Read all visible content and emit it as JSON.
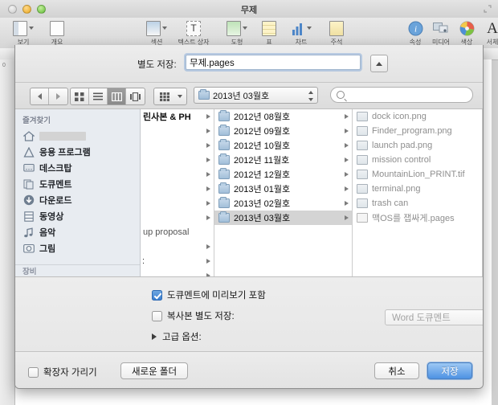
{
  "app": {
    "title": "무제",
    "window_controls": [
      "close",
      "minimize",
      "zoom"
    ],
    "toolbar_left": [
      {
        "label": "보기",
        "icon": "view-icon",
        "has_menu": true
      },
      {
        "label": "개요",
        "icon": "outline-icon",
        "has_menu": false
      }
    ],
    "toolbar_center": [
      {
        "label": "섹션",
        "icon": "sections-icon",
        "has_menu": true
      },
      {
        "label": "텍스트 상자",
        "icon": "textbox-icon",
        "has_menu": false
      },
      {
        "label": "도형",
        "icon": "shapes-icon",
        "has_menu": true
      },
      {
        "label": "표",
        "icon": "table-icon",
        "has_menu": false
      },
      {
        "label": "차트",
        "icon": "chart-icon",
        "has_menu": true
      },
      {
        "label": "주석",
        "icon": "comment-icon",
        "has_menu": false
      }
    ],
    "toolbar_right": [
      {
        "label": "속성",
        "icon": "inspector-icon"
      },
      {
        "label": "미디어",
        "icon": "media-icon"
      },
      {
        "label": "색상",
        "icon": "colors-icon"
      },
      {
        "label": "서체",
        "icon": "fonts-icon"
      }
    ],
    "ruler_mark": "0"
  },
  "sheet": {
    "save_as_label": "별도 저장:",
    "filename_value": "무제.pages",
    "expand_button_icon": "triangle-up-icon",
    "nav": {
      "back_icon": "arrow-left-icon",
      "forward_icon": "arrow-right-icon",
      "view_modes": [
        {
          "name": "icon-view",
          "selected": false
        },
        {
          "name": "list-view",
          "selected": false
        },
        {
          "name": "column-view",
          "selected": true
        },
        {
          "name": "coverflow-view",
          "selected": false
        }
      ],
      "arrange_icon": "arrange-icon",
      "path_label": "2013년 03월호",
      "search_placeholder": ""
    },
    "sidebar": {
      "header": "즐겨찾기",
      "items": [
        {
          "label": "",
          "icon": "home-icon",
          "redacted": true
        },
        {
          "label": "응용 프로그램",
          "icon": "applications-icon"
        },
        {
          "label": "데스크탑",
          "icon": "desktop-icon"
        },
        {
          "label": "도큐멘트",
          "icon": "documents-icon"
        },
        {
          "label": "다운로드",
          "icon": "downloads-icon"
        },
        {
          "label": "동영상",
          "icon": "movies-icon"
        },
        {
          "label": "음악",
          "icon": "music-icon"
        },
        {
          "label": "그림",
          "icon": "pictures-icon"
        }
      ],
      "devices_header": "장비"
    },
    "columns": [
      {
        "name": "column-1",
        "items": [
          {
            "label": "린사본 & PH",
            "type": "folder",
            "truncated": true,
            "selected": false
          },
          {
            "label": "",
            "type": "blank"
          },
          {
            "label": "",
            "type": "blank"
          },
          {
            "label": "",
            "type": "blank"
          },
          {
            "label": "",
            "type": "blank"
          },
          {
            "label": "",
            "type": "blank"
          },
          {
            "label": "",
            "type": "blank"
          },
          {
            "label": "",
            "type": "blank"
          },
          {
            "label": "up proposal",
            "type": "folder",
            "truncated": true,
            "selected": false
          },
          {
            "label": "",
            "type": "blank"
          },
          {
            "label": "",
            "type": "blank"
          }
        ]
      },
      {
        "name": "column-2",
        "items": [
          {
            "label": "2012년 08월호",
            "type": "folder",
            "selected": false
          },
          {
            "label": "2012년 09월호",
            "type": "folder",
            "selected": false
          },
          {
            "label": "2012년 10월호",
            "type": "folder",
            "selected": false
          },
          {
            "label": "2012년 11월호",
            "type": "folder",
            "selected": false
          },
          {
            "label": "2012년 12월호",
            "type": "folder",
            "selected": false
          },
          {
            "label": "2013년 01월호",
            "type": "folder",
            "selected": false
          },
          {
            "label": "2013년 02월호",
            "type": "folder",
            "selected": false
          },
          {
            "label": "2013년 03월호",
            "type": "folder",
            "selected": true
          }
        ]
      },
      {
        "name": "column-3",
        "items": [
          {
            "label": "dock icon.png",
            "type": "image",
            "selected": false
          },
          {
            "label": "Finder_program.png",
            "type": "image",
            "selected": false
          },
          {
            "label": "launch pad.png",
            "type": "image",
            "selected": false
          },
          {
            "label": "mission control",
            "type": "image",
            "selected": false
          },
          {
            "label": "MountainLion_PRINT.tif",
            "type": "image",
            "selected": false
          },
          {
            "label": "terminal.png",
            "type": "image",
            "selected": false
          },
          {
            "label": "trash can",
            "type": "image",
            "selected": false
          },
          {
            "label": "맥OS를 잽싸게.pages",
            "type": "document",
            "selected": false
          }
        ]
      }
    ],
    "options": {
      "include_preview": {
        "label": "도큐멘트에 미리보기 포함",
        "checked": true
      },
      "save_copy": {
        "label": "복사본 별도 저장:",
        "checked": false
      },
      "format_value": "Word 도큐멘트",
      "advanced": {
        "label": "고급 옵션:",
        "expanded": false
      }
    },
    "footer": {
      "hide_extension": {
        "label": "확장자 가리기",
        "checked": false
      },
      "new_folder_label": "새로운 폴더",
      "cancel_label": "취소",
      "save_label": "저장"
    }
  },
  "colors": {
    "accent_blue": "#4e92e3",
    "sidebar_bg": "#e8ecf1",
    "selection_grey": "#d4d4d4",
    "checkbox_blue": "#3b7fd0"
  }
}
